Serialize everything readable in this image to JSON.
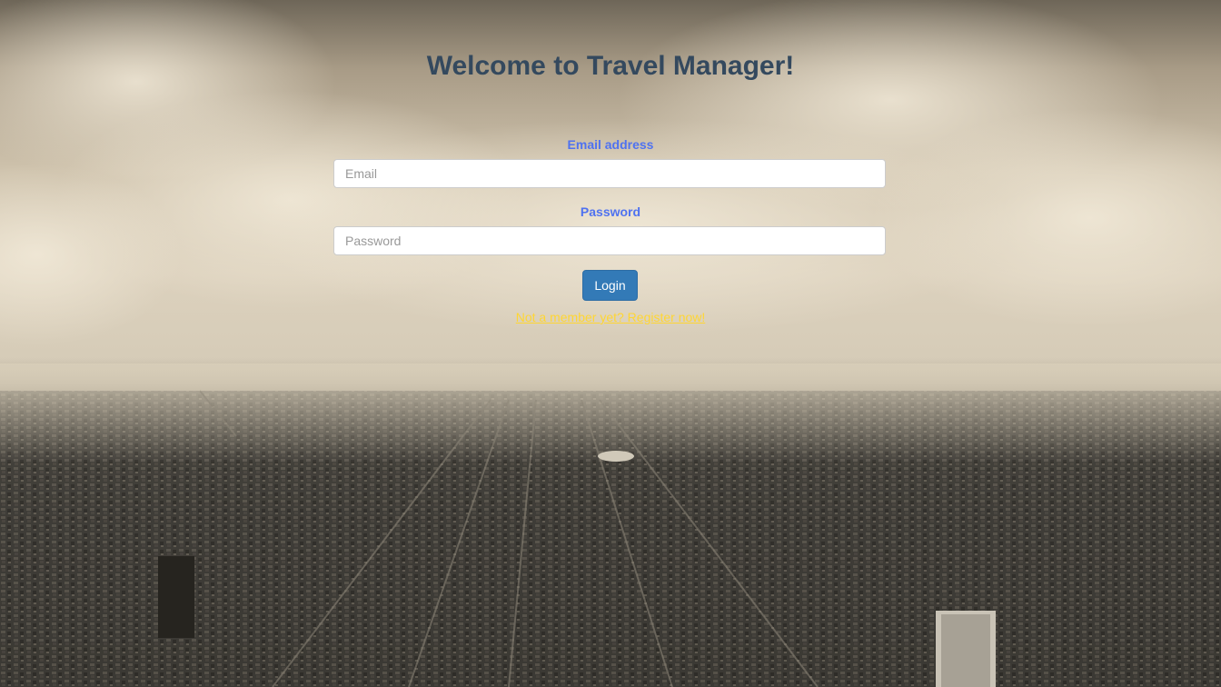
{
  "page": {
    "title": "Welcome to Travel Manager!"
  },
  "form": {
    "email_label": "Email address",
    "email_placeholder": "Email",
    "email_value": "",
    "password_label": "Password",
    "password_placeholder": "Password",
    "password_value": "",
    "login_label": "Login",
    "register_link": "Not a member yet? Register now!"
  },
  "colors": {
    "title": "#34495e",
    "label": "#4f72f0",
    "button": "#337ab7",
    "link": "#ffd633"
  },
  "background": {
    "description_icon": "city-skyline-photo"
  }
}
